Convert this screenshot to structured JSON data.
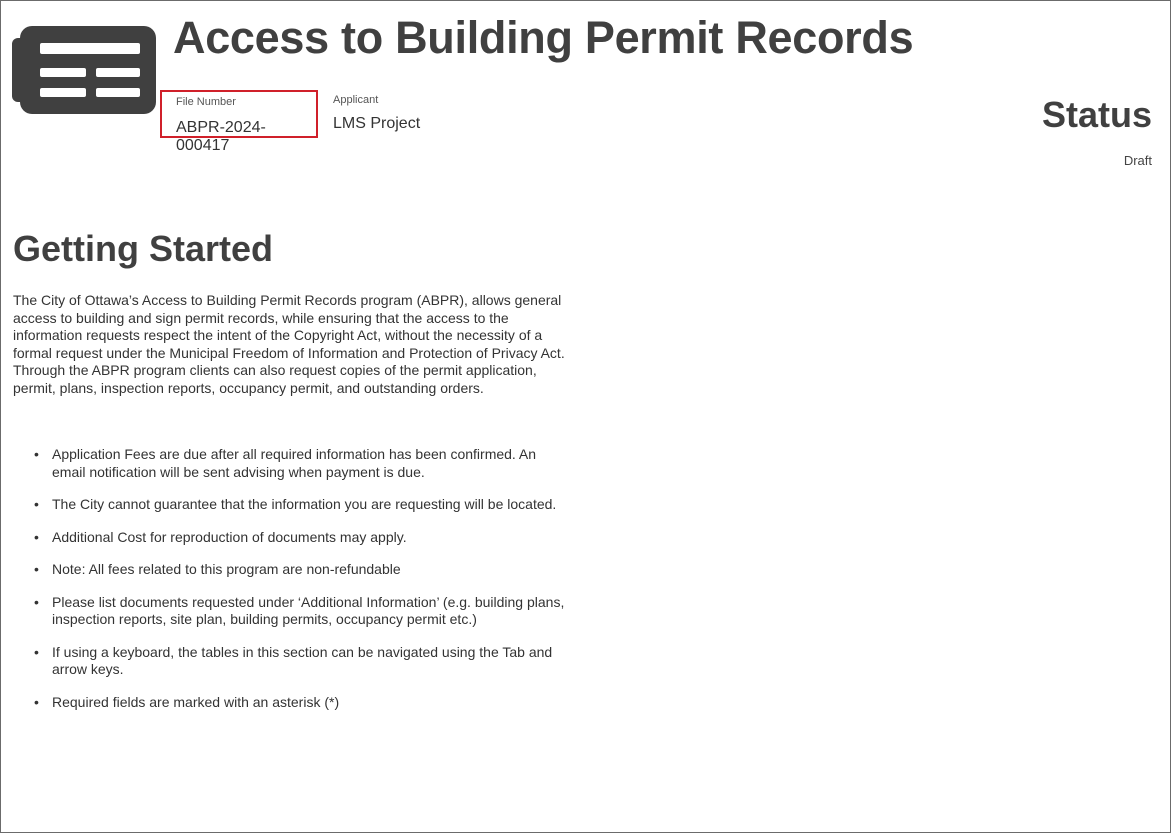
{
  "header": {
    "title": "Access to Building Permit Records",
    "icon": "document-list-icon",
    "file_number_label": "File Number",
    "file_number": "ABPR-2024-000417",
    "applicant_label": "Applicant",
    "applicant": "LMS Project",
    "status_label": "Status",
    "status": "Draft",
    "highlight_color": "#d0202a"
  },
  "getting_started": {
    "heading": "Getting Started",
    "intro": "The City of Ottawa’s Access to Building Permit Records program (ABPR), allows general access to building and sign permit records, while ensuring that the access to the information requests respect the intent of the Copyright Act, without the necessity of a formal request under the Municipal Freedom of Information and Protection of Privacy Act. Through the ABPR program clients can also request copies of the permit application, permit, plans, inspection reports, occupancy permit, and outstanding orders.",
    "notes": [
      "Application Fees are due after all required information has been confirmed. An email notification will be sent advising when payment is due.",
      "The City cannot guarantee that the information you are requesting will be located.",
      "Additional Cost for reproduction of documents may apply.",
      "Note: All fees related to this program are non-refundable",
      "Please list documents requested under ‘Additional Information’ (e.g. building plans, inspection reports, site plan, building permits, occupancy permit etc.)",
      "If using a keyboard, the tables in this section can be navigated using the Tab and arrow keys.",
      "Required fields are marked with an asterisk (*)"
    ]
  }
}
